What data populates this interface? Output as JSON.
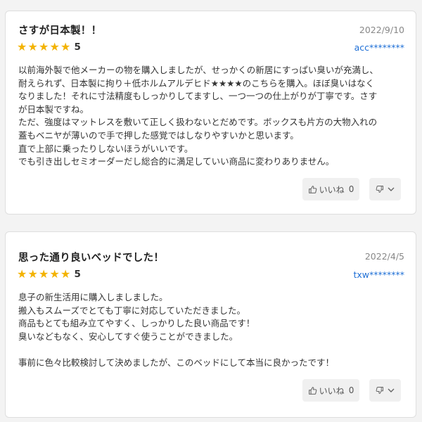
{
  "reviews": [
    {
      "title": "さすが日本製！！",
      "date": "2022/9/10",
      "rating": "5",
      "user": "acc********",
      "body": [
        "以前海外製で他メーカーの物を購入しましたが、せっかくの新居にすっぱい臭いが充満し、",
        "耐えられず、日本製に拘り＋低ホルムアルデヒド★★★★のこちらを購入。ほぼ臭いはなく",
        "なりました！それに寸法精度もしっかりしてますし、一つ一つの仕上がりが丁寧です。さす",
        "が日本製ですね。",
        "ただ、強度はマットレスを敷いて正しく扱わないとだめです。ボックスも片方の大物入れの",
        "蓋もベニヤが薄いので手で押した感覚ではしなりやすいかと思います。",
        "直で上部に乗ったりしないほうがいいです。",
        "でも引き出しセミオーダーだし総合的に満足していい商品に変わりありません。"
      ],
      "helpful_label": "いいね",
      "helpful_count": "0"
    },
    {
      "title": "思った通り良いベッドでした！",
      "date": "2022/4/5",
      "rating": "5",
      "user": "txw********",
      "body": [
        "息子の新生活用に購入しましました。",
        "搬入もスムーズでとても丁寧に対応していただきました。",
        "商品もとても組み立てやすく、しっかりした良い商品です！",
        "臭いなどもなく、安心してすぐ使うことができました。",
        "",
        "事前に色々比較検討して決めましたが、このベッドにして本当に良かったです！"
      ],
      "helpful_label": "いいね",
      "helpful_count": "0"
    }
  ],
  "icons": {
    "star": "star-icon",
    "helpful": "thumbs-up-icon",
    "unhelpful": "thumbs-down-icon",
    "more": "chevron-down-icon"
  },
  "colors": {
    "star": "#f3b300",
    "user_link": "#1e6fd6",
    "date": "#888888",
    "button_bg": "#f0f0f0"
  }
}
